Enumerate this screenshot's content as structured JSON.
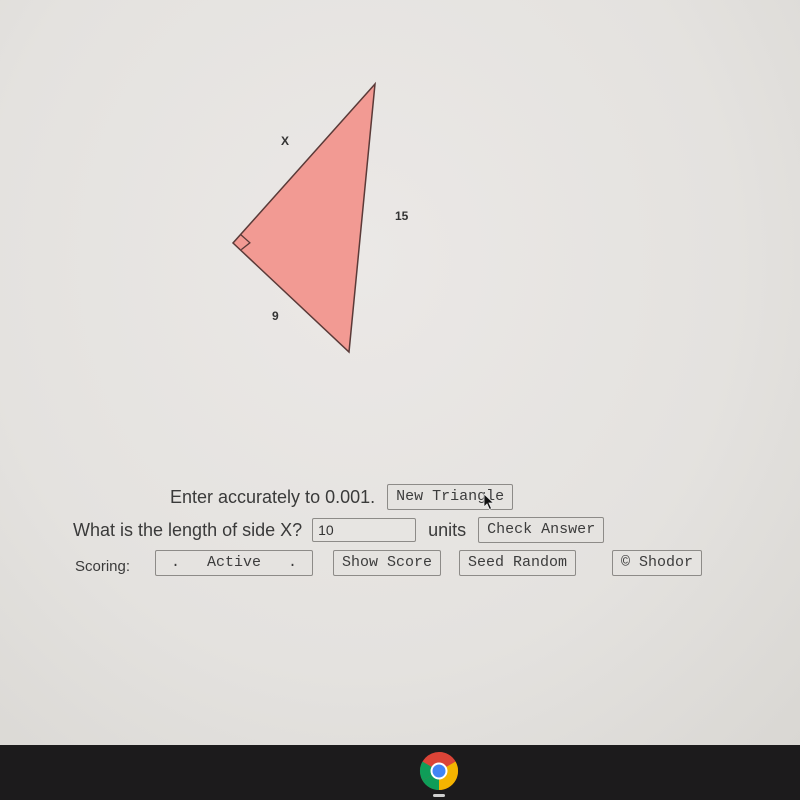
{
  "figure": {
    "shape": "right-triangle",
    "fill_color": "#f29a93",
    "stroke_color": "#5a3a38",
    "labels": {
      "hypotenuse_side": "X",
      "vertical_side": "15",
      "bottom_side": "9"
    },
    "right_angle_marker": true
  },
  "controls": {
    "instruction_text": "Enter accurately to 0.001.",
    "new_triangle_label": "New Triangle",
    "question_text": "What is the length of side X?",
    "answer_value": "10",
    "units_label": "units",
    "check_answer_label": "Check Answer",
    "scoring_label": "Scoring:",
    "scoring_mode_label": ".   Active   .",
    "show_score_label": "Show Score",
    "seed_random_label": "Seed Random",
    "shodor_label": "© Shodor"
  },
  "taskbar": {
    "apps": [
      {
        "name": "Google Chrome",
        "icon": "chrome-icon",
        "active": true
      }
    ]
  }
}
